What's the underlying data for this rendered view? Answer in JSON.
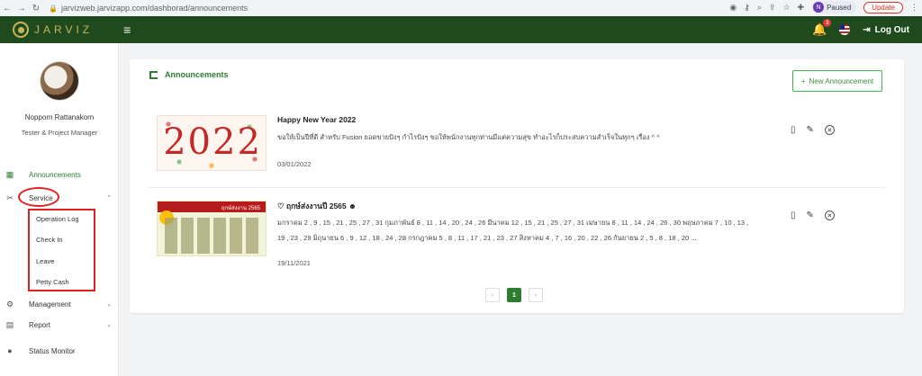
{
  "browser": {
    "url": "jarvizweb.jarvizapp.com/dashborad/announcements",
    "profile_initial": "N",
    "profile_status": "Paused",
    "update_label": "Update"
  },
  "header": {
    "logo_text": "JARVIZ",
    "notification_count": "3",
    "logout_label": "Log Out"
  },
  "user": {
    "name": "Nopporn Rattanakorn",
    "role": "Tester & Project Manager"
  },
  "sidebar": {
    "items": [
      {
        "label": "Announcements",
        "icon": "announcement-icon"
      },
      {
        "label": "Service",
        "icon": "tools-icon"
      },
      {
        "label": "Management",
        "icon": "gear-icon"
      },
      {
        "label": "Report",
        "icon": "report-icon"
      },
      {
        "label": "Status Monitor",
        "icon": "location-icon"
      }
    ],
    "service_sub": [
      "Operation Log",
      "Check In",
      "Leave",
      "Petty Cash"
    ]
  },
  "main": {
    "title": "Announcements",
    "new_button": "New Announcement",
    "announcements": [
      {
        "title": "Happy New Year 2022",
        "body": "ขอให้เป็นปีที่ดี สำหรับ Fusion ยอดขายปังๆ กำไรปังๆ ขอให้พนักงานทุกท่านมีแต่ความสุข ทำอะไรก็ประสบความสำเร็จในทุกๆ เรื่อง ^ ^",
        "date": "03/01/2022",
        "thumb_text": "2022"
      },
      {
        "title": "ฤกษ์ส่งงานปี 2565",
        "body": "มกราคม 2 , 9 , 15 , 21 , 25 , 27 , 31 กุมภาพันธ์ 8 , 11 , 14 , 20 , 24 , 26 มีนาคม 12 , 15 , 21 , 25 , 27 , 31 เมษายน 8 , 11 , 14 , 24 , 26 , 30 พฤษภาคม 7 , 10 , 13 , 19 , 23 , 29 มิถุนายน 6 , 9 , 12 , 18 , 24 , 28 กรกฎาคม 5 , 8 , 11 , 17 , 21 , 23 , 27 สิงหาคม 4 , 7 , 16 , 20 , 22 , 26 กันยายน 2 , 5 , 8 , 18 , 20 ...",
        "date": "19/11/2021",
        "thumb_text": "ฤกษ์ส่งงาน 2565"
      }
    ],
    "pager": {
      "current": "1",
      "prev": "‹",
      "next": "›"
    }
  }
}
